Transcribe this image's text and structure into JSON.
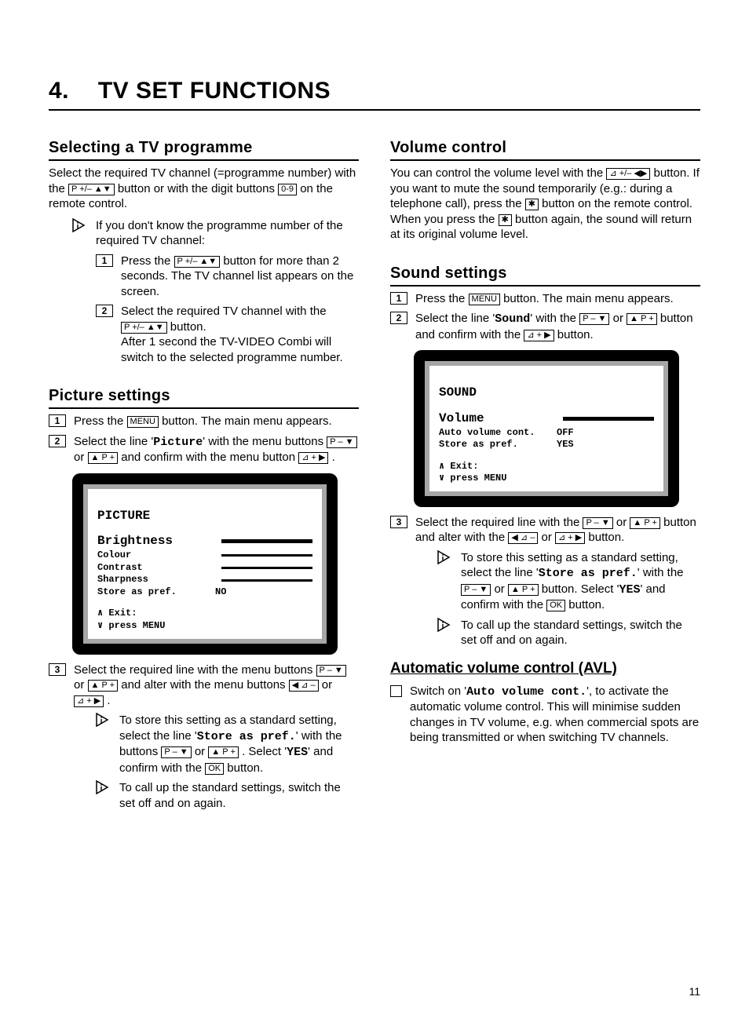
{
  "page_number": "11",
  "chapter": {
    "num": "4.",
    "title": "TV SET FUNCTIONS"
  },
  "keys": {
    "p_pm_udarrows": "P +/– ▲▼",
    "digits": "0-9",
    "menu": "MENU",
    "p_minus_down": "P – ▼",
    "up_p_plus": "▲ P +",
    "vol_plus_right": "⊿ + ▶",
    "left_vol_minus": "◀ ⊿ –",
    "vol_pm_lr": "⊿ +/– ◀▶",
    "mute": "✱",
    "ok": "OK"
  },
  "left": {
    "selecting": {
      "heading": "Selecting a TV programme",
      "intro_1": "Select the required TV channel (=programme number) with the ",
      "intro_2": " button or with the digit buttons ",
      "intro_3": " on the remote control.",
      "tip": "If you don't know the programme number of the required TV channel:",
      "step1_a": "Press the ",
      "step1_b": " button for more than 2 seconds. The TV channel list appears on the screen.",
      "step2_a": "Select the required TV channel with the ",
      "step2_b": " button.",
      "step2_c": "After 1 second the TV-VIDEO Combi will switch to the selected programme number."
    },
    "picture": {
      "heading": "Picture settings",
      "step1_a": "Press the ",
      "step1_b": " button. The main menu appears.",
      "step2_a": "Select the line '",
      "step2_menu": "Picture",
      "step2_b": "' with the menu buttons ",
      "step2_c": " or ",
      "step2_d": " and confirm with the menu button ",
      "step2_e": ".",
      "osd": {
        "title": "PICTURE",
        "rows": [
          {
            "label": "Brightness",
            "type": "bar",
            "big": true
          },
          {
            "label": "Colour",
            "type": "bar"
          },
          {
            "label": "Contrast",
            "type": "bar"
          },
          {
            "label": "Sharpness",
            "type": "bar"
          },
          {
            "label": "Store as pref.",
            "value": "NO"
          }
        ],
        "footer1": "∧ Exit:",
        "footer2": "∨ press MENU"
      },
      "step3_a": "Select the required line with the menu buttons ",
      "step3_b": " or ",
      "step3_c": " and alter with the menu buttons ",
      "step3_d": " or ",
      "step3_e": ".",
      "tip1_a": "To store this setting as a standard setting, select the line '",
      "tip1_menu": "Store as pref.",
      "tip1_b": "' with the buttons ",
      "tip1_c": " or ",
      "tip1_d": ". Select '",
      "tip1_yes": "YES",
      "tip1_e": "' and confirm with the ",
      "tip1_f": " button.",
      "tip2": "To call up the standard settings, switch the set off and on again."
    }
  },
  "right": {
    "volume": {
      "heading": "Volume control",
      "p_a": "You can control the volume level with the ",
      "p_b": " button. If you want to mute the sound temporarily (e.g.: during a telephone call), press the ",
      "p_c": " button on the remote control. When you press the ",
      "p_d": " button again, the sound will return at its original volume level."
    },
    "sound": {
      "heading": "Sound settings",
      "step1_a": "Press the ",
      "step1_b": " button. The main menu appears.",
      "step2_a": "Select the line '",
      "step2_menu": "Sound",
      "step2_b": "' with the ",
      "step2_c": " or ",
      "step2_d": " button and confirm with the ",
      "step2_e": " button.",
      "osd": {
        "title": "SOUND",
        "rows": [
          {
            "label": "Volume",
            "type": "bar",
            "big": true
          },
          {
            "label": "Auto volume cont.",
            "value": "OFF"
          },
          {
            "label": "Store as pref.",
            "value": "YES"
          }
        ],
        "footer1": "∧ Exit:",
        "footer2": "∨ press MENU"
      },
      "step3_a": "Select the required line with the ",
      "step3_b": " or ",
      "step3_c": " button and alter with the ",
      "step3_d": " or ",
      "step3_e": " button.",
      "tip1_a": "To store this setting as a standard setting, select the line '",
      "tip1_menu": "Store as pref.",
      "tip1_b": "' with the ",
      "tip1_c": " or ",
      "tip1_d": " button. Select '",
      "tip1_yes": "YES",
      "tip1_e": "' and confirm with the ",
      "tip1_f": " button.",
      "tip2": "To call up the standard settings, switch the set off and on again."
    },
    "avl": {
      "heading": "Automatic volume control (AVL)",
      "chk_a": "Switch on '",
      "chk_menu": "Auto volume cont.",
      "chk_b": "', to activate the automatic volume control. This will minimise sudden changes in TV volume, e.g. when commercial spots are being transmitted or when switching TV channels."
    }
  }
}
